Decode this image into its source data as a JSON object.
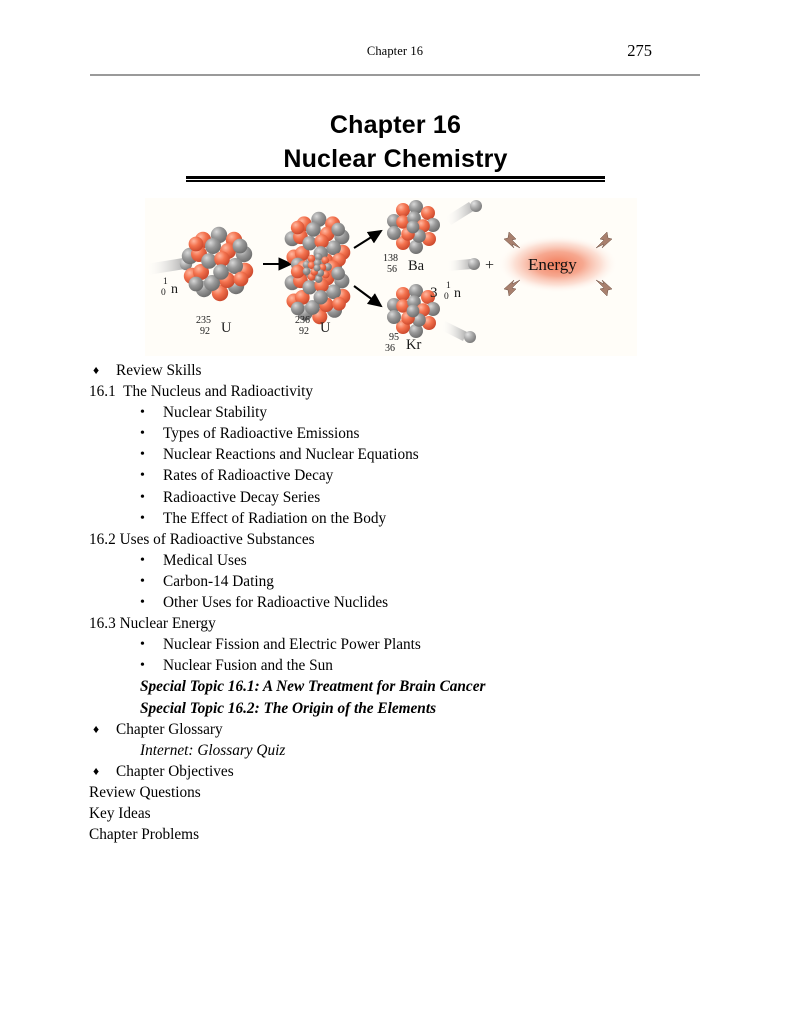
{
  "header": {
    "running_title": "Chapter 16",
    "page_number": "275"
  },
  "title": {
    "line1": "Chapter 16",
    "line2": "Nuclear Chemistry"
  },
  "figure": {
    "name": "nuclear-fission-diagram",
    "background_color": "#fffdf8",
    "nucleon_color_a": "#ef6b4e",
    "nucleon_color_b": "#8e8e8e",
    "energy_glow_color": "#ef6b4e",
    "labels": {
      "incoming_neutron": {
        "superscript": "1",
        "subscript": "0",
        "symbol": "n"
      },
      "uranium_235": {
        "superscript": "235",
        "subscript": "92",
        "symbol": "U"
      },
      "uranium_236": {
        "superscript": "236",
        "subscript": "92",
        "symbol": "U"
      },
      "barium_138": {
        "superscript": "138",
        "subscript": "56",
        "symbol": "Ba"
      },
      "krypton_95": {
        "superscript": "95",
        "subscript": "36",
        "symbol": "Kr"
      },
      "emitted_neutrons": {
        "count": "3",
        "superscript": "1",
        "subscript": "0",
        "symbol": "n"
      },
      "plus_sign": "+",
      "energy": "Energy"
    }
  },
  "outline": [
    {
      "level": "diamond",
      "bullet": "♦",
      "text": "Review Skills"
    },
    {
      "level": "section",
      "text": "16.1  The Nucleus and Radioactivity"
    },
    {
      "level": "bullet",
      "bullet": "•",
      "text": "Nuclear Stability"
    },
    {
      "level": "bullet",
      "bullet": "•",
      "text": "Types of Radioactive Emissions"
    },
    {
      "level": "bullet",
      "bullet": "•",
      "text": "Nuclear Reactions and Nuclear Equations"
    },
    {
      "level": "bullet",
      "bullet": "•",
      "text": "Rates of Radioactive Decay"
    },
    {
      "level": "bullet",
      "bullet": "•",
      "text": "Radioactive Decay Series"
    },
    {
      "level": "bullet",
      "bullet": "•",
      "text": "The Effect of Radiation on the Body"
    },
    {
      "level": "section",
      "text": "16.2 Uses of Radioactive Substances"
    },
    {
      "level": "bullet",
      "bullet": "•",
      "text": "Medical Uses"
    },
    {
      "level": "bullet",
      "bullet": "•",
      "text": "Carbon-14 Dating"
    },
    {
      "level": "bullet",
      "bullet": "•",
      "text": "Other Uses for Radioactive Nuclides"
    },
    {
      "level": "section",
      "text": "16.3 Nuclear Energy"
    },
    {
      "level": "bullet",
      "bullet": "•",
      "text": "Nuclear Fission and Electric Power Plants"
    },
    {
      "level": "bullet",
      "bullet": "•",
      "text": "Nuclear Fusion and the Sun"
    },
    {
      "level": "special",
      "text": "Special Topic 16.1: A New Treatment for Brain Cancer"
    },
    {
      "level": "special",
      "text": "Special Topic 16.2: The Origin of the Elements"
    },
    {
      "level": "diamond",
      "bullet": "♦",
      "text": "Chapter Glossary"
    },
    {
      "level": "internet",
      "text": "Internet: Glossary Quiz"
    },
    {
      "level": "diamond",
      "bullet": "♦",
      "text": "Chapter Objectives"
    },
    {
      "level": "plain",
      "text": "Review Questions"
    },
    {
      "level": "plain",
      "text": "Key Ideas"
    },
    {
      "level": "plain",
      "text": "Chapter Problems"
    }
  ]
}
